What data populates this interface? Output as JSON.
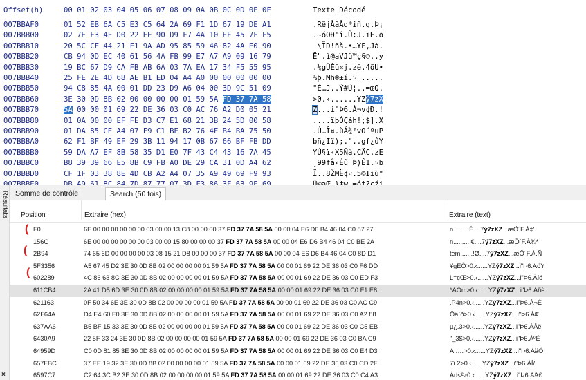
{
  "hex_view": {
    "header": {
      "offset_label": "Offset(h)",
      "columns": "00 01 02 03 04 05 06 07 08 09 0A 0B 0C 0D 0E 0F",
      "text_label": "Texte Décodé"
    },
    "rows": [
      {
        "offset": "007BBAF0",
        "bytes": "01 52 EB 6A C5 E3 C5 64 2A 69 F1 1D 67 19 DE A1",
        "text": ".RëjÅãÅd*iñ.g.Þ¡"
      },
      {
        "offset": "007BBB00",
        "bytes": "02 7E F3 4F D0 22 EE 90 D9 F7 4A 10 EF 45 7F F5",
        "text": ".~óOÐ\"î.Ù÷J.ïE.õ"
      },
      {
        "offset": "007BBB10",
        "bytes": "20 5C CF 44 21 F1 9A AD 95 85 59 46 82 4A E0 90",
        "text": " \\ÏD!ñš.•…YF‚Jà."
      },
      {
        "offset": "007BBB20",
        "bytes": "CB 94 0D EC 40 61 56 4A FB 99 E7 A7 A9 09 16 79",
        "text": "Ë\".ì@aVJû™ç§©..y"
      },
      {
        "offset": "007BBB30",
        "bytes": "19 BC 67 D9 CA FB AB 6A 03 7A EA 17 34 F5 55 95",
        "text": ".¼gÙÊû«j.zê.4õU•"
      },
      {
        "offset": "007BBB40",
        "bytes": "25 FE 2E 4D 68 AE B1 ED 04 A4 A0 00 00 00 00 00",
        "text": "%þ.Mh®±í.¤ ....."
      },
      {
        "offset": "007BBB50",
        "bytes": "94 C8 85 4A 00 01 DD 23 D9 A6 04 00 3D 9C 51 09",
        "text": "\"È…J..Ý#Ù¦..=œQ."
      },
      {
        "offset": "007BBB60",
        "bytes_pre": "3E 30 0D 8B 02 00 00 00 00 01 59 5A",
        "bytes_sel": "FD 37 7A 58",
        "text_pre": ">0.‹......YZ",
        "text_sel": "ý7zX"
      },
      {
        "offset": "007BBB70",
        "bytes_cur": "5A",
        "bytes_post": " 00 00 01 69 22 DE 36 03 C0 AC 76 A2 D0 05 21",
        "text_cur": "Z",
        "text_post": "...i\"Þ6.À¬v¢Ð.!"
      },
      {
        "offset": "007BBB80",
        "bytes": "01 0A 00 00 EF FE D3 C7 E1 68 21 3B 24 5D 00 58",
        "text": "....ïþÓÇáh!;$].X"
      },
      {
        "offset": "007BBB90",
        "bytes": "01 DA 85 CE A4 07 F9 C1 BE B2 76 4F B4 BA 75 50",
        "text": ".Ú…Î¤.ùÁ¾²vO´ºuP"
      },
      {
        "offset": "007BBBA0",
        "bytes": "62 F1 BF 49 EF 29 3B 11 94 17 0B 67 66 BF FB DD",
        "text": "bñ¿Iï);.\"..gf¿ûÝ"
      },
      {
        "offset": "007BBBB0",
        "bytes": "59 DA A7 EF 8B 58 35 D1 E0 7F 43 C4 43 16 7A 45",
        "text": "YÚ§ï‹X5Ñà.CÄC.zE"
      },
      {
        "offset": "007BBBC0",
        "bytes": "B8 39 39 66 E5 8B C9 FB A0 DE 29 CA 31 0D A4 62",
        "text": "¸99få‹Éû Þ)Ê1.¤b"
      },
      {
        "offset": "007BBBD0",
        "bytes": "CF 1F 03 38 8E 4D CB A2 A4 07 35 A9 49 69 F9 93",
        "text": "Ï..8ŽMË¢¤.5©Iiù\""
      },
      {
        "offset": "007BBBE0",
        "bytes": "DB A9 61 8C 84 7D 87 77 07 3D F3 86 3F 63 9E 69",
        "text": "Û©aŒ„}‡w.=ó†?cži"
      }
    ]
  },
  "side_panel": {
    "label": "Résultats",
    "close_glyph": "×"
  },
  "tabs": [
    {
      "label": "Somme de contrôle"
    },
    {
      "label": "Search (50 fois)"
    }
  ],
  "results": {
    "columns": [
      "Position",
      "Extraire (hex)",
      "Extraire (text)"
    ],
    "rows": [
      {
        "pos": "F0",
        "hex_pre": "6E 00 00 00 00 00 00 03 00 00 13 C8 00 00 00 37 ",
        "hex_bold": "FD 37 7A 58 5A",
        "hex_post": " 00 00 04 E6 D6 B4 46 04 C0 87 27",
        "txt_pre": "n.........È....7",
        "txt_bold": "ý7zXZ",
        "txt_post": "...æÖ´F.À‡'"
      },
      {
        "pos": "156C",
        "hex_pre": "6E 00 00 00 00 00 00 03 00 00 15 80 00 00 00 37 ",
        "hex_bold": "FD 37 7A 58 5A",
        "hex_post": " 00 00 04 E6 D6 B4 46 04 C0 BE 2A",
        "txt_pre": "n..........€....7",
        "txt_bold": "ý7zXZ",
        "txt_post": "...æÖ´F.À¾*"
      },
      {
        "pos": "2B94",
        "hex_pre": "74 65 6D 00 00 00 00 03 08 15 21 D8 00 00 00 37 ",
        "hex_bold": "FD 37 7A 58 5A",
        "hex_post": " 00 00 04 E6 D6 B4 46 04 C0 8D D1",
        "txt_pre": "tem.......!Ø....7",
        "txt_bold": "ý7zXZ",
        "txt_post": "...æÖ´F.À.Ñ"
      },
      {
        "pos": "5F3356",
        "hex_pre": "A5 67 45 D2 3E 30 0D 8B 02 00 00 00 00 01 59 5A ",
        "hex_bold": "FD 37 7A 58 5A",
        "hex_post": " 00 00 01 69 22 DE 36 03 C0 F6 DD",
        "txt_pre": "¥gEÒ>0.‹......YZ",
        "txt_bold": "ý7zXZ",
        "txt_post": "...i\"Þ6.ÀöÝ"
      },
      {
        "pos": "602289",
        "hex_pre": "4C 86 63 8C 3E 30 0D 8B 02 00 00 00 00 01 59 5A ",
        "hex_bold": "FD 37 7A 58 5A",
        "hex_post": " 00 00 01 69 22 DE 36 03 C0 ED F3",
        "txt_pre": "L†cŒ>0.‹......YZ",
        "txt_bold": "ý7zXZ",
        "txt_post": "...i\"Þ6.Àíó"
      },
      {
        "pos": "611CB4",
        "hex_pre": "2A 41 D5 6D 3E 30 0D 8B 02 00 00 00 00 01 59 5A ",
        "hex_bold": "FD 37 7A 58 5A",
        "hex_post": " 00 00 01 69 22 DE 36 03 C0 F1 E8",
        "txt_pre": "*AÕm>0.‹......YZ",
        "txt_bold": "ý7zXZ",
        "txt_post": "...i\"Þ6.Àñè",
        "highlight": true
      },
      {
        "pos": "621163",
        "hex_pre": "0F 50 34 6E 3E 30 0D 8B 02 00 00 00 00 01 59 5A ",
        "hex_bold": "FD 37 7A 58 5A",
        "hex_post": " 00 00 01 69 22 DE 36 03 C0 AC C9",
        "txt_pre": ".P4n>0.‹......YZ",
        "txt_bold": "ý7zXZ",
        "txt_post": "...i\"Þ6.À¬É"
      },
      {
        "pos": "62F64A",
        "hex_pre": "D4 E4 60 F0 3E 30 0D 8B 02 00 00 00 00 01 59 5A ",
        "hex_bold": "FD 37 7A 58 5A",
        "hex_post": " 00 00 01 69 22 DE 36 03 C0 A2 88",
        "txt_pre": "Ôä`ð>0.‹......YZ",
        "txt_bold": "ý7zXZ",
        "txt_post": "...i\"Þ6.À¢ˆ"
      },
      {
        "pos": "637AA6",
        "hex_pre": "B5 BF 15 33 3E 30 0D 8B 02 00 00 00 00 01 59 5A ",
        "hex_bold": "FD 37 7A 58 5A",
        "hex_post": " 00 00 01 69 22 DE 36 03 C0 C5 EB",
        "txt_pre": "µ¿.3>0.‹......YZ",
        "txt_bold": "ý7zXZ",
        "txt_post": "...i\"Þ6.ÀÅë"
      },
      {
        "pos": "6430A9",
        "hex_pre": "22 5F 33 24 3E 30 0D 8B 02 00 00 00 00 01 59 5A ",
        "hex_bold": "FD 37 7A 58 5A",
        "hex_post": " 00 00 01 69 22 DE 36 03 C0 BA C9",
        "txt_pre": "\"_3$>0.‹......YZ",
        "txt_bold": "ý7zXZ",
        "txt_post": "...i\"Þ6.ÀºÉ"
      },
      {
        "pos": "64959D",
        "hex_pre": "C0 0D 81 85 3E 30 0D 8B 02 00 00 00 00 01 59 5A ",
        "hex_bold": "FD 37 7A 58 5A",
        "hex_post": " 00 00 01 69 22 DE 36 03 C0 E4 D3",
        "txt_pre": "À..…>0.‹......YZ",
        "txt_bold": "ý7zXZ",
        "txt_post": "...i\"Þ6.ÀäÓ"
      },
      {
        "pos": "657FBC",
        "hex_pre": "37 EE 19 32 3E 30 0D 8B 02 00 00 00 00 01 59 5A ",
        "hex_bold": "FD 37 7A 58 5A",
        "hex_post": " 00 00 01 69 22 DE 36 03 C0 CD 2F",
        "txt_pre": "7î.2>0.‹......YZ",
        "txt_bold": "ý7zXZ",
        "txt_post": "...i\"Þ6.ÀÍ/"
      },
      {
        "pos": "6597C7",
        "hex_pre": "C2 64 3C B2 3E 30 0D 8B 02 00 00 00 00 01 59 5A ",
        "hex_bold": "FD 37 7A 58 5A",
        "hex_post": " 00 00 01 69 22 DE 36 03 C0 C4 A3",
        "txt_pre": "Âd<²>0.‹......YZ",
        "txt_bold": "ý7zXZ",
        "txt_post": "...i\"Þ6.ÀÄ£"
      }
    ]
  },
  "annotation": {
    "color": "#e02020",
    "glyph": "("
  }
}
